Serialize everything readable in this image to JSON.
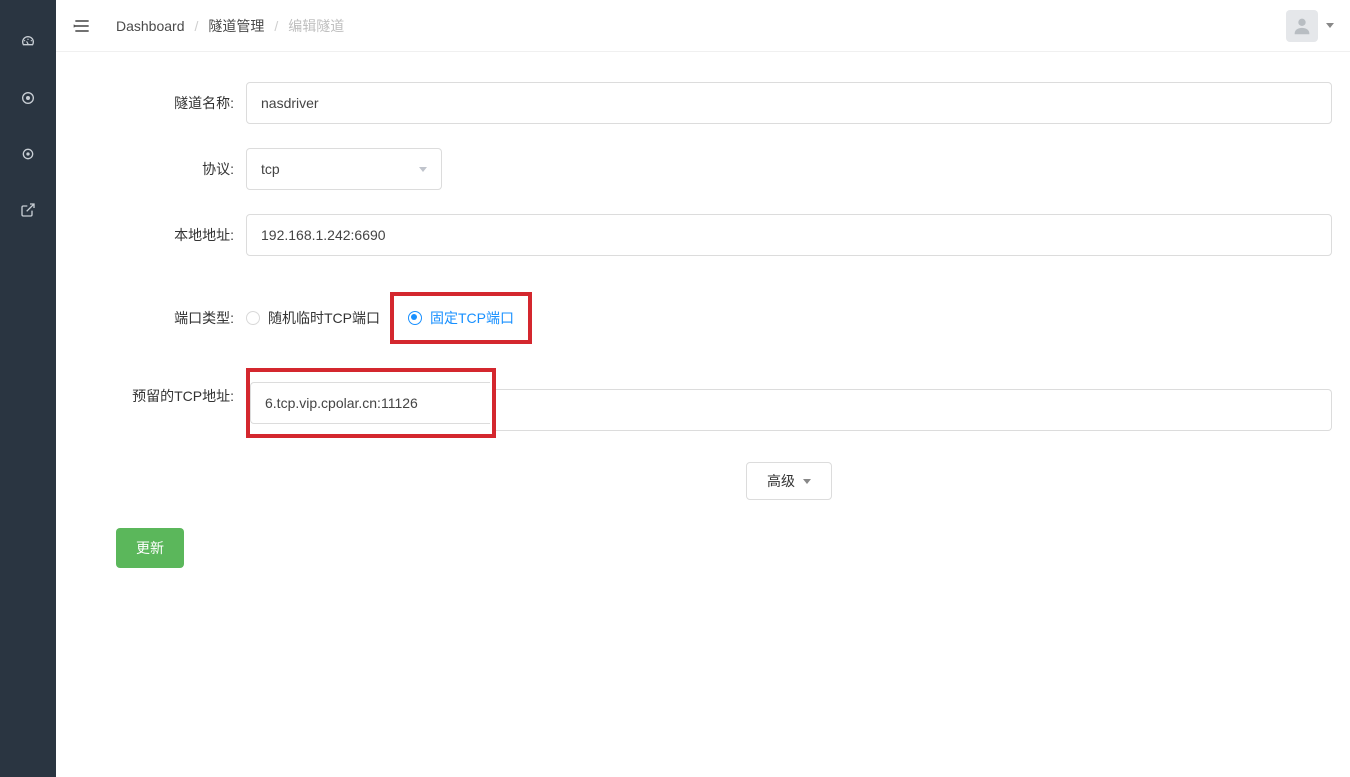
{
  "breadcrumb": {
    "item1": "Dashboard",
    "item2": "隧道管理",
    "item3": "编辑隧道"
  },
  "form": {
    "tunnel_name_label": "隧道名称:",
    "tunnel_name_value": "nasdriver",
    "protocol_label": "协议:",
    "protocol_value": "tcp",
    "local_addr_label": "本地地址:",
    "local_addr_value": "192.168.1.242:6690",
    "port_type_label": "端口类型:",
    "port_type_random": "随机临时TCP端口",
    "port_type_fixed": "固定TCP端口",
    "reserved_tcp_label": "预留的TCP地址:",
    "reserved_tcp_value": "6.tcp.vip.cpolar.cn:11126",
    "advanced_label": "高级",
    "submit_label": "更新"
  }
}
